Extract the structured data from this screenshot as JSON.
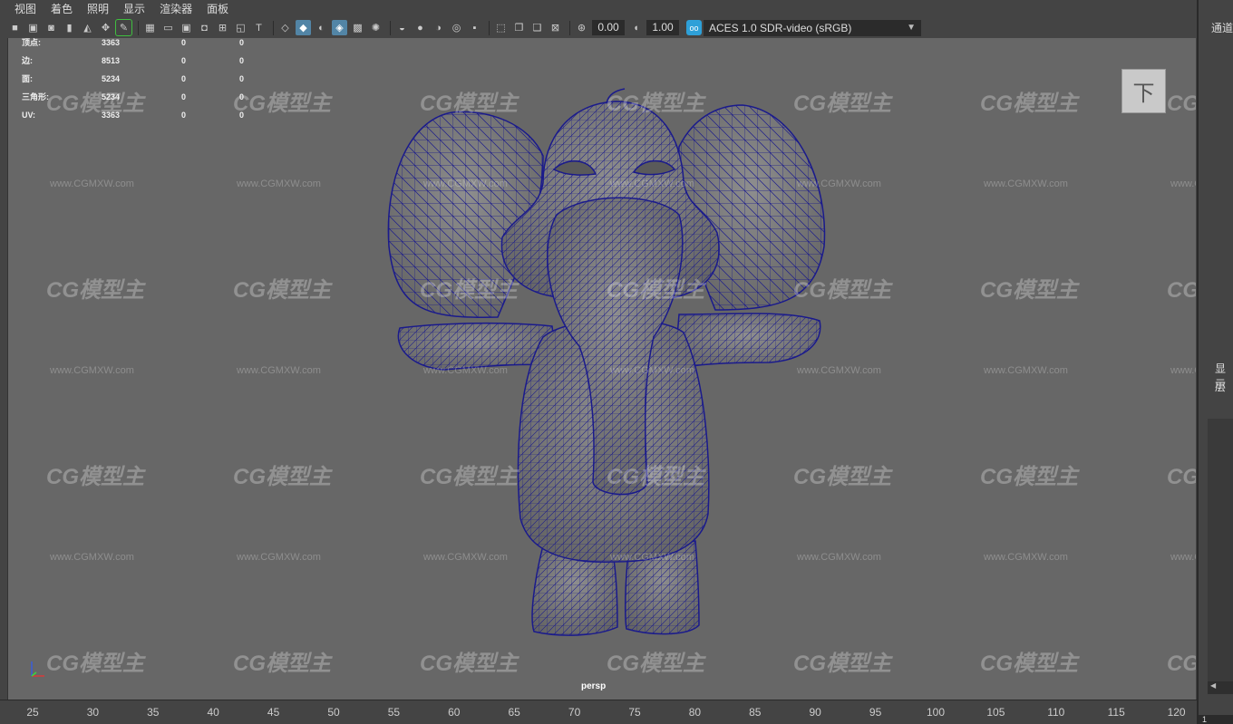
{
  "menu": [
    "视图",
    "着色",
    "照明",
    "显示",
    "渲染器",
    "面板"
  ],
  "toolbar": {
    "exposure_value": "0.00",
    "gamma_value": "1.00",
    "color_space": "ACES 1.0 SDR-video (sRGB)"
  },
  "hud": {
    "rows": [
      {
        "label": "顶点:",
        "v1": "3363",
        "v2": "0",
        "v3": "0"
      },
      {
        "label": "边:",
        "v1": "8513",
        "v2": "0",
        "v3": "0"
      },
      {
        "label": "面:",
        "v1": "5234",
        "v2": "0",
        "v3": "0"
      },
      {
        "label": "三角形:",
        "v1": "5234",
        "v2": "0",
        "v3": "0"
      },
      {
        "label": "UV:",
        "v1": "3363",
        "v2": "0",
        "v3": "0"
      }
    ]
  },
  "viewport": {
    "camera": "persp",
    "view_cube_label": "下",
    "watermark_text": "CG模型主",
    "watermark_url": "www.CGMXW.com"
  },
  "right_panel": {
    "channel_tab": "通道",
    "display_tab": "显示",
    "layer_tab": "层",
    "field_value": "1"
  },
  "timeline": {
    "ticks": [
      "25",
      "30",
      "35",
      "40",
      "45",
      "50",
      "55",
      "60",
      "65",
      "70",
      "75",
      "80",
      "85",
      "90",
      "95",
      "100",
      "105",
      "110",
      "115",
      "120"
    ]
  },
  "colors": {
    "viewport_bg": "#676767",
    "wireframe": "#1a1a8c",
    "accent": "#5285a6"
  }
}
